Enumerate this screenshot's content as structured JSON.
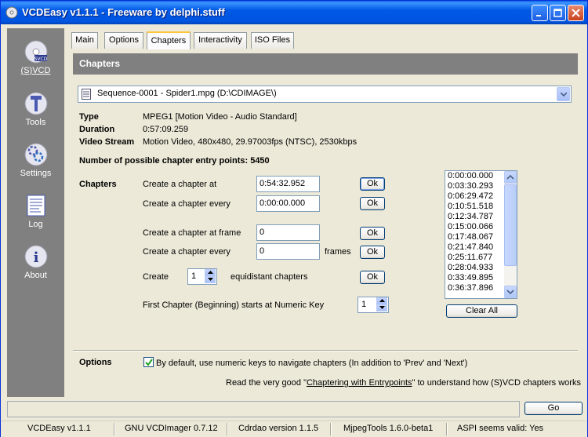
{
  "window": {
    "title": "VCDEasy v1.1.1 - Freeware by delphi.stuff"
  },
  "sidebar": {
    "items": [
      {
        "label": "(S)VCD",
        "icon": "cd-icon",
        "active": true
      },
      {
        "label": "Tools",
        "icon": "tools-icon"
      },
      {
        "label": "Settings",
        "icon": "settings-icon"
      },
      {
        "label": "Log",
        "icon": "log-icon"
      },
      {
        "label": "About",
        "icon": "info-icon"
      }
    ]
  },
  "tabs": [
    {
      "label": "Main"
    },
    {
      "label": "Options"
    },
    {
      "label": "Chapters",
      "active": true
    },
    {
      "label": "Interactivity"
    },
    {
      "label": "ISO Files"
    }
  ],
  "panel": {
    "header": "Chapters",
    "sequence_select": "Sequence-0001 - Spider1.mpg  (D:\\CDIMAGE\\)",
    "info": {
      "type_label": "Type",
      "type_value": "MPEG1  [Motion Video - Audio Standard]",
      "duration_label": "Duration",
      "duration_value": "0:57:09.259",
      "video_label": "Video Stream",
      "video_value": "Motion Video, 480x480, 29.97003fps (NTSC), 2530kbps"
    },
    "entry_points": "Number of possible chapter entry points: 5450",
    "chapters_label": "Chapters",
    "rows": {
      "at_label": "Create a chapter at",
      "at_value": "0:54:32.952",
      "every_label": "Create a chapter every",
      "every_value": "0:00:00.000",
      "at_frame_label": "Create a chapter at frame",
      "at_frame_value": "0",
      "every_frames_label": "Create a chapter every",
      "every_frames_value": "0",
      "frames_unit": "frames",
      "create_label": "Create",
      "create_value": "1",
      "equidistant_label": "equidistant chapters",
      "first_chapter_label": "First Chapter (Beginning) starts at Numeric Key",
      "first_chapter_value": "1",
      "ok_label": "Ok"
    },
    "chapter_list": [
      "0:00:00.000",
      "0:03:30.293",
      "0:06:29.472",
      "0:10:51.518",
      "0:12:34.787",
      "0:15:00.066",
      "0:17:48.067",
      "0:21:47.840",
      "0:25:11.677",
      "0:28:04.933",
      "0:33:49.895",
      "0:36:37.896"
    ],
    "clear_all": "Clear All",
    "options_label": "Options",
    "option_checkbox": "By default, use numeric keys to navigate chapters (In addition to 'Prev' and 'Next')",
    "read_prefix": "Read the very good \"",
    "read_link": "Chaptering with Entrypoints",
    "read_suffix": "\" to understand how (S)VCD chapters works"
  },
  "go_label": "Go",
  "status": {
    "s1": "VCDEasy v1.1.1",
    "s2": "GNU VCDImager 0.7.12",
    "s3": "Cdrdao version 1.1.5",
    "s4": "MjpegTools 1.6.0-beta1",
    "s5": "ASPI seems valid: Yes"
  }
}
